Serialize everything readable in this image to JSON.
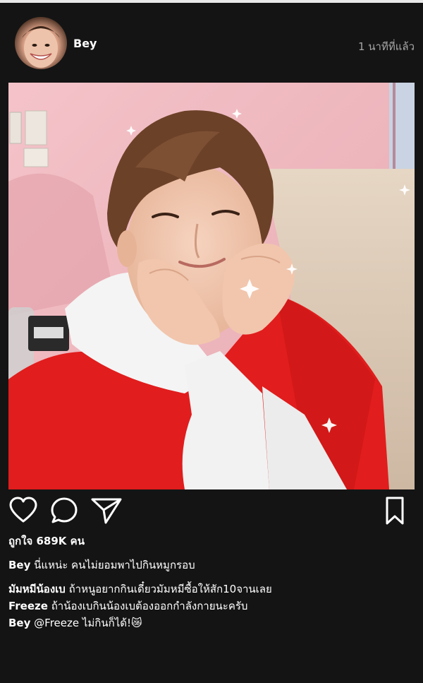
{
  "post": {
    "username": "Bey",
    "time": "1 นาทีที่แล้ว",
    "likes": "ถูกใจ 689K คน",
    "caption": {
      "user": "Bey",
      "text": " นี่แหน่ะ คนไม่ยอมพาไปกินหมูกรอบ"
    },
    "comments": [
      {
        "user": "มัมหมีน้องเบ",
        "text": " ถ้าหนูอยากกินเดี๋ยวมัมหมีซื้อให้สัก10จานเลย"
      },
      {
        "user": "Freeze",
        "text": " ถ้าน้องเบกินน้องเบต้องออกกำลังกายนะครับ"
      },
      {
        "user": "Bey",
        "text": " @Freeze ไม่กินก็ได้!😿"
      }
    ]
  },
  "icons": {
    "like": "heart-icon",
    "comment": "comment-icon",
    "share": "paper-plane-icon",
    "save": "bookmark-icon"
  },
  "colors": {
    "background": "#141414",
    "text": "#ffffff",
    "muted": "#a6a6a6"
  }
}
